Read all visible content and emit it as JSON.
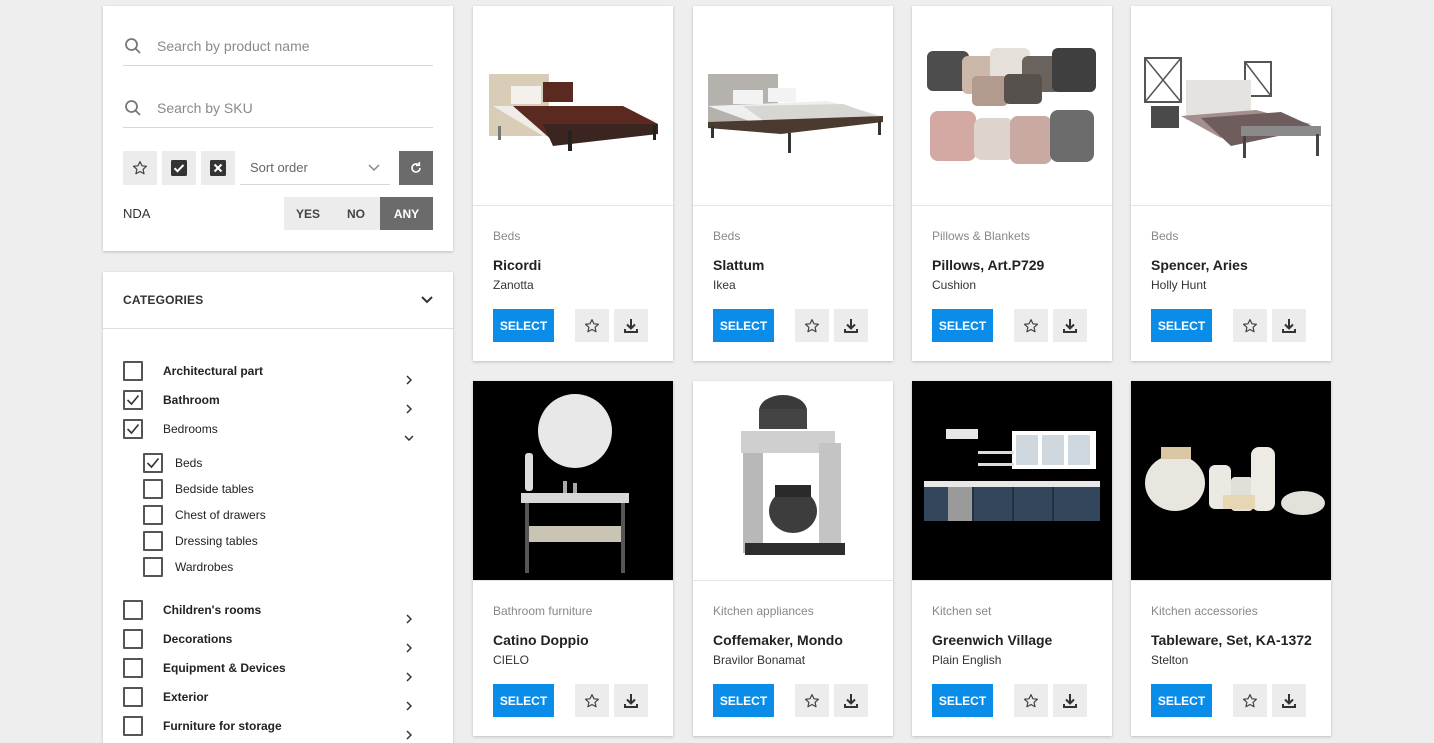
{
  "filters": {
    "search_name_placeholder": "Search by product name",
    "search_sku_placeholder": "Search by SKU",
    "sort_placeholder": "Sort order",
    "nda_label": "NDA",
    "nda_options": [
      "YES",
      "NO",
      "ANY"
    ],
    "nda_selected": "ANY"
  },
  "categories": {
    "header": "CATEGORIES",
    "items": [
      {
        "label": "Architectural part",
        "checked": false
      },
      {
        "label": "Bathroom",
        "checked": true
      },
      {
        "label": "Bedrooms",
        "checked": true,
        "expanded": true
      },
      {
        "label": "Children's rooms",
        "checked": false
      },
      {
        "label": "Decorations",
        "checked": false
      },
      {
        "label": "Equipment & Devices",
        "checked": false
      },
      {
        "label": "Exterior",
        "checked": false
      },
      {
        "label": "Furniture for storage",
        "checked": false
      }
    ],
    "bedrooms_children": [
      {
        "label": "Beds",
        "checked": true
      },
      {
        "label": "Bedside tables",
        "checked": false
      },
      {
        "label": "Chest of drawers",
        "checked": false
      },
      {
        "label": "Dressing tables",
        "checked": false
      },
      {
        "label": "Wardrobes",
        "checked": false
      }
    ]
  },
  "products": [
    {
      "category": "Beds",
      "name": "Ricordi",
      "brand": "Zanotta",
      "image": "bed-icon"
    },
    {
      "category": "Beds",
      "name": "Slattum",
      "brand": "Ikea",
      "image": "bed-icon"
    },
    {
      "category": "Pillows & Blankets",
      "name": "Pillows, Art.P729",
      "brand": "Cushion",
      "image": "pillows-icon"
    },
    {
      "category": "Beds",
      "name": "Spencer, Aries",
      "brand": "Holly Hunt",
      "image": "bed-icon"
    },
    {
      "category": "Bathroom furniture",
      "name": "Catino Doppio",
      "brand": "CIELO",
      "image": "vanity-icon"
    },
    {
      "category": "Kitchen appliances",
      "name": "Coffemaker, Mondo",
      "brand": "Bravilor Bonamat",
      "image": "coffeemaker-icon"
    },
    {
      "category": "Kitchen set",
      "name": "Greenwich Village",
      "brand": "Plain English",
      "image": "kitchen-icon"
    },
    {
      "category": "Kitchen accessories",
      "name": "Tableware, Set, KA-1372",
      "brand": "Stelton",
      "image": "tableware-icon"
    }
  ],
  "select_label": "SELECT",
  "colors": {
    "accent": "#0a8de8",
    "dark_button": "#6b6b6b",
    "background": "#eeeeee"
  }
}
